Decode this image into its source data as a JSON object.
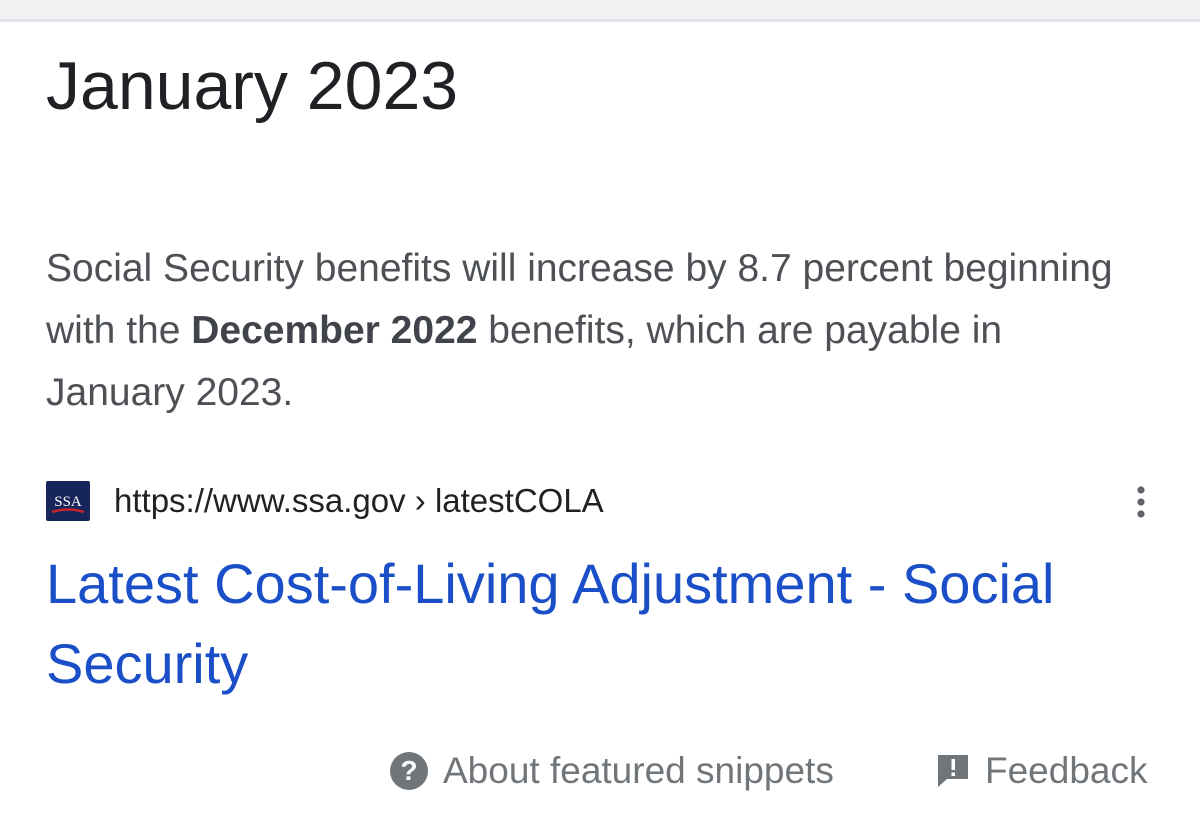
{
  "featured_snippet": {
    "answer_title": "January 2023",
    "text_before_bold": "Social Security benefits will increase by 8.7 percent beginning with the ",
    "text_bold": "December 2022",
    "text_after_bold": " benefits, which are payable in January 2023."
  },
  "source": {
    "favicon_text": "SSA",
    "url": "https://www.ssa.gov › latestCOLA",
    "more_icon": "more-vert-icon"
  },
  "result": {
    "title": "Latest Cost-of-Living Adjustment - Social Security"
  },
  "footer": {
    "about_label": "About featured snippets",
    "about_icon": "help-icon",
    "feedback_label": "Feedback",
    "feedback_icon": "feedback-icon"
  },
  "colors": {
    "link": "#1a4fc8",
    "body_text": "#4d5156",
    "title_text": "#202124",
    "muted": "#70757a",
    "favicon_bg": "#16265a"
  }
}
